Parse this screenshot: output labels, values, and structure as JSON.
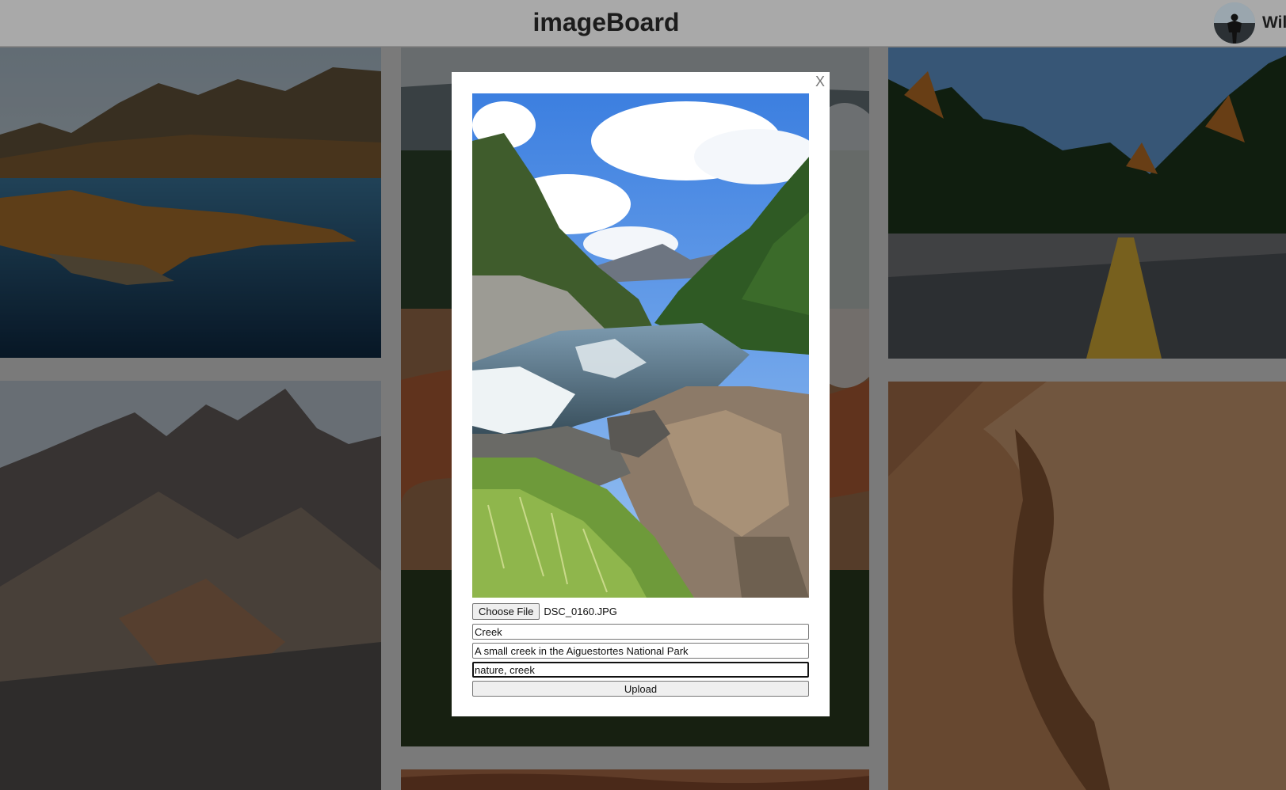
{
  "header": {
    "title": "imageBoard",
    "username": "Wil"
  },
  "gallery": {
    "cards": [
      {
        "subject": "mountain-lake"
      },
      {
        "subject": "geyser-forest"
      },
      {
        "subject": "autumn-road"
      },
      {
        "subject": "rocky-mountain"
      },
      {
        "subject": "desert-dunes"
      },
      {
        "subject": "canyon"
      }
    ]
  },
  "modal": {
    "close_label": "X",
    "preview": {
      "subject": "mountain creek"
    },
    "file_button_label": "Choose File",
    "file_name": "DSC_0160.JPG",
    "title_value": "Creek",
    "description_value": "A small creek in the Aiguestortes National Park",
    "tags_value": "nature, creek",
    "upload_label": "Upload"
  },
  "colors": {
    "page_background": "#7a7a7a",
    "header_background": "#a9a9a9",
    "modal_background": "#ffffff",
    "button_background": "#efefef"
  }
}
